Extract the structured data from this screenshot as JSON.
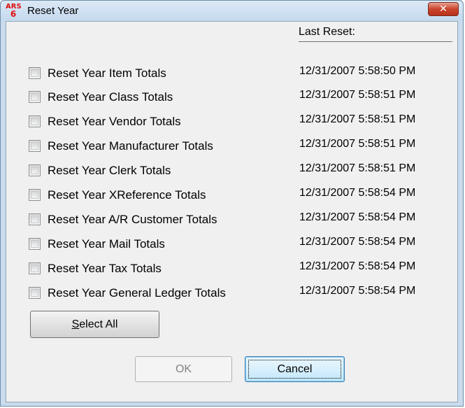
{
  "window": {
    "title": "Reset Year",
    "app_icon_text": [
      "ARS",
      "6"
    ],
    "close_glyph": "✕"
  },
  "header": {
    "last_reset_label": "Last Reset:"
  },
  "items": [
    {
      "label": "Reset Year Item Totals",
      "last_reset": "12/31/2007 5:58:50 PM",
      "checked": false
    },
    {
      "label": "Reset Year Class Totals",
      "last_reset": "12/31/2007 5:58:51 PM",
      "checked": false
    },
    {
      "label": "Reset Year Vendor Totals",
      "last_reset": "12/31/2007 5:58:51 PM",
      "checked": false
    },
    {
      "label": "Reset Year Manufacturer Totals",
      "last_reset": "12/31/2007 5:58:51 PM",
      "checked": false
    },
    {
      "label": "Reset Year Clerk Totals",
      "last_reset": "12/31/2007 5:58:51 PM",
      "checked": false
    },
    {
      "label": "Reset Year XReference Totals",
      "last_reset": "12/31/2007 5:58:54 PM",
      "checked": false
    },
    {
      "label": "Reset Year A/R Customer Totals",
      "last_reset": "12/31/2007 5:58:54 PM",
      "checked": false
    },
    {
      "label": "Reset Year Mail Totals",
      "last_reset": "12/31/2007 5:58:54 PM",
      "checked": false
    },
    {
      "label": "Reset Year Tax Totals",
      "last_reset": "12/31/2007 5:58:54 PM",
      "checked": false
    },
    {
      "label": "Reset Year General Ledger Totals",
      "last_reset": "12/31/2007 5:58:54 PM",
      "checked": false
    }
  ],
  "buttons": {
    "select_all_mnemonic": "S",
    "select_all_rest": "elect All",
    "ok": "OK",
    "ok_enabled": false,
    "cancel": "Cancel"
  }
}
